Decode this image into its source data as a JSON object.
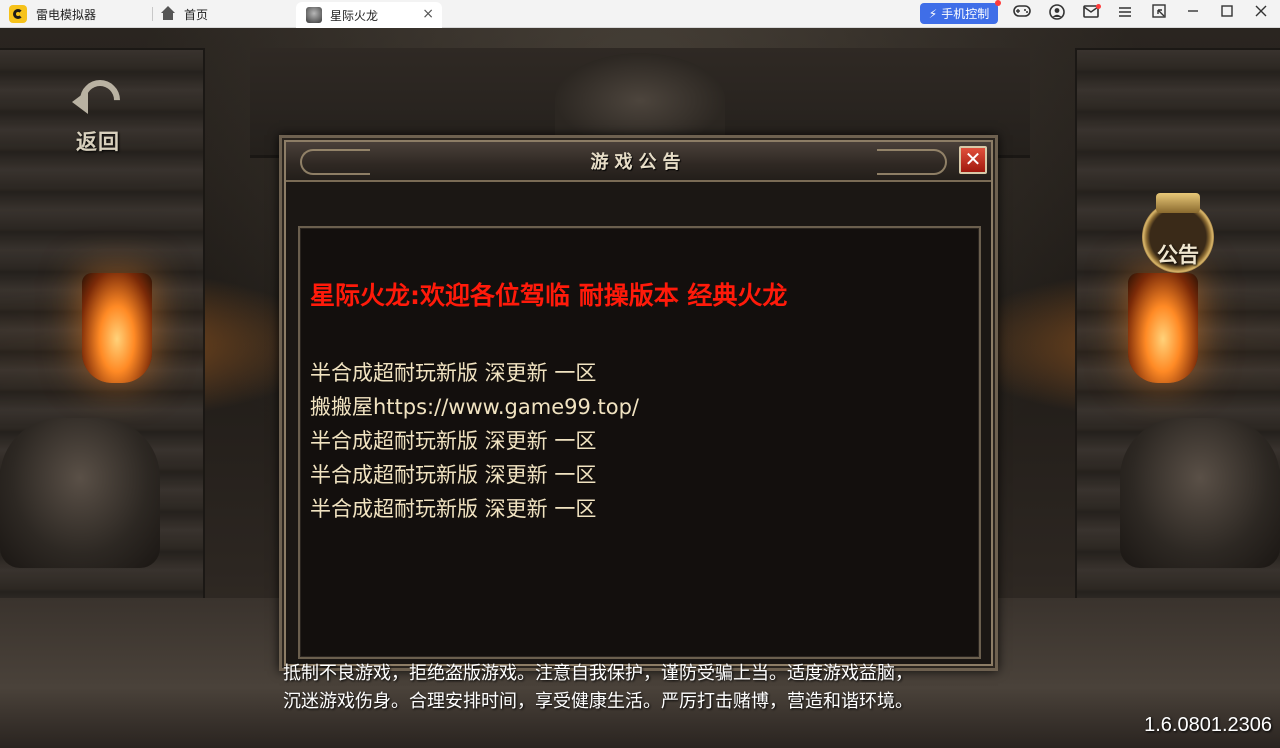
{
  "emulator": {
    "app_title": "雷电模拟器",
    "tabs": [
      {
        "label": "首页"
      },
      {
        "label": "星际火龙",
        "close": "×"
      }
    ],
    "mobile_control_label": "手机控制",
    "toolbar_icons": [
      "gamepad-icon",
      "user-icon",
      "mail-icon",
      "menu-icon",
      "shrink-icon",
      "minimize-icon",
      "maximize-icon",
      "close-icon"
    ]
  },
  "game": {
    "back_label": "返回",
    "notice_button_label": "公告",
    "dialog": {
      "title": "游戏公告",
      "close_symbol": "✕",
      "headline": "星际火龙:欢迎各位驾临 耐操版本 经典火龙",
      "lines": [
        "半合成超耐玩新版 深更新 一区",
        "搬搬屋https://www.game99.top/",
        "半合成超耐玩新版 深更新 一区",
        "半合成超耐玩新版 深更新 一区",
        "半合成超耐玩新版 深更新 一区"
      ]
    },
    "health_notice": [
      "抵制不良游戏，拒绝盗版游戏。注意自我保护，谨防受骗上当。适度游戏益脑，",
      "沉迷游戏伤身。合理安排时间，享受健康生活。严厉打击赌博，营造和谐环境。"
    ],
    "version": "1.6.0801.2306"
  },
  "colors": {
    "headline": "#ff1a0a",
    "body_text": "#f1e3c1",
    "mobile_control_bg": "#3f6ee8"
  }
}
